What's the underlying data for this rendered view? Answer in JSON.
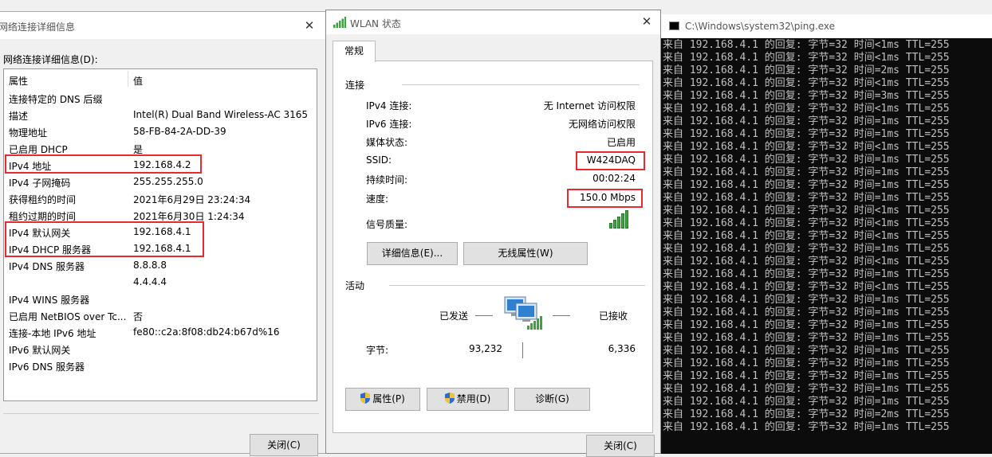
{
  "details_dialog": {
    "title": "网络连接详细信息",
    "caption": "网络连接详细信息(D):",
    "columns": {
      "property": "属性",
      "value": "值"
    },
    "rows": [
      {
        "k": "连接特定的 DNS 后缀",
        "v": ""
      },
      {
        "k": "描述",
        "v": "Intel(R) Dual Band Wireless-AC 3165"
      },
      {
        "k": "物理地址",
        "v": "58-FB-84-2A-DD-39"
      },
      {
        "k": "已启用 DHCP",
        "v": "是"
      },
      {
        "k": "IPv4 地址",
        "v": "192.168.4.2"
      },
      {
        "k": "IPv4 子网掩码",
        "v": "255.255.255.0"
      },
      {
        "k": "获得租约的时间",
        "v": "2021年6月29日 23:24:34"
      },
      {
        "k": "租约过期的时间",
        "v": "2021年6月30日 1:24:34"
      },
      {
        "k": "IPv4 默认网关",
        "v": "192.168.4.1"
      },
      {
        "k": "IPv4 DHCP 服务器",
        "v": "192.168.4.1"
      },
      {
        "k": "IPv4 DNS 服务器",
        "v": "8.8.8.8"
      },
      {
        "k": "",
        "v": "4.4.4.4"
      },
      {
        "k": "IPv4 WINS 服务器",
        "v": ""
      },
      {
        "k": "已启用 NetBIOS over Tc...",
        "v": "否"
      },
      {
        "k": "连接-本地 IPv6 地址",
        "v": "fe80::c2a:8f08:db24:b67d%16"
      },
      {
        "k": "IPv6 默认网关",
        "v": ""
      },
      {
        "k": "IPv6 DNS 服务器",
        "v": ""
      }
    ],
    "close_label": "关闭(C)"
  },
  "wlan_dialog": {
    "title": "WLAN 状态",
    "tab": "常规",
    "connection_group": "连接",
    "fields": [
      {
        "k": "IPv4 连接:",
        "v": "无 Internet 访问权限"
      },
      {
        "k": "IPv6 连接:",
        "v": "无网络访问权限"
      },
      {
        "k": "媒体状态:",
        "v": "已启用"
      },
      {
        "k": "SSID:",
        "v": "W424DAQ"
      },
      {
        "k": "持续时间:",
        "v": "00:02:24"
      },
      {
        "k": "速度:",
        "v": "150.0 Mbps"
      }
    ],
    "signal_label": "信号质量:",
    "details_button": "详细信息(E)...",
    "wireless_props_button": "无线属性(W)",
    "activity_group": "活动",
    "sent_label": "已发送",
    "received_label": "已接收",
    "bytes_label": "字节:",
    "bytes_sent": "93,232",
    "bytes_received": "6,336",
    "properties_button": "属性(P)",
    "disable_button": "禁用(D)",
    "diagnose_button": "诊断(G)",
    "close_label": "关闭(C)"
  },
  "ping_console": {
    "title": "C:\\Windows\\system32\\ping.exe",
    "lines": [
      "来自 192.168.4.1 的回复: 字节=32 时间<1ms TTL=255",
      "来自 192.168.4.1 的回复: 字节=32 时间<1ms TTL=255",
      "来自 192.168.4.1 的回复: 字节=32 时间=2ms TTL=255",
      "来自 192.168.4.1 的回复: 字节=32 时间<1ms TTL=255",
      "来自 192.168.4.1 的回复: 字节=32 时间=3ms TTL=255",
      "来自 192.168.4.1 的回复: 字节=32 时间<1ms TTL=255",
      "来自 192.168.4.1 的回复: 字节=32 时间=1ms TTL=255",
      "来自 192.168.4.1 的回复: 字节=32 时间=1ms TTL=255",
      "来自 192.168.4.1 的回复: 字节=32 时间<1ms TTL=255",
      "来自 192.168.4.1 的回复: 字节=32 时间=1ms TTL=255",
      "来自 192.168.4.1 的回复: 字节=32 时间=1ms TTL=255",
      "来自 192.168.4.1 的回复: 字节=32 时间=1ms TTL=255",
      "来自 192.168.4.1 的回复: 字节=32 时间=1ms TTL=255",
      "来自 192.168.4.1 的回复: 字节=32 时间<1ms TTL=255",
      "来自 192.168.4.1 的回复: 字节=32 时间<1ms TTL=255",
      "来自 192.168.4.1 的回复: 字节=32 时间<1ms TTL=255",
      "来自 192.168.4.1 的回复: 字节=32 时间=1ms TTL=255",
      "来自 192.168.4.1 的回复: 字节=32 时间<1ms TTL=255",
      "来自 192.168.4.1 的回复: 字节=32 时间=1ms TTL=255",
      "来自 192.168.4.1 的回复: 字节=32 时间<1ms TTL=255",
      "来自 192.168.4.1 的回复: 字节=32 时间=1ms TTL=255",
      "来自 192.168.4.1 的回复: 字节=32 时间=1ms TTL=255",
      "来自 192.168.4.1 的回复: 字节=32 时间=1ms TTL=255",
      "来自 192.168.4.1 的回复: 字节=32 时间=1ms TTL=255",
      "来自 192.168.4.1 的回复: 字节=32 时间=1ms TTL=255",
      "来自 192.168.4.1 的回复: 字节=32 时间=1ms TTL=255",
      "来自 192.168.4.1 的回复: 字节=32 时间=1ms TTL=255",
      "来自 192.168.4.1 的回复: 字节=32 时间=1ms TTL=255",
      "来自 192.168.4.1 的回复: 字节=32 时间=1ms TTL=255",
      "来自 192.168.4.1 的回复: 字节=32 时间=2ms TTL=255",
      "来自 192.168.4.1 的回复: 字节=32 时间=1ms TTL=255"
    ]
  },
  "colors": {
    "highlight_box": "#e8292f",
    "console_bg": "#0c0c0c",
    "console_text": "#c0c0c0",
    "signal_green": "#3aa53a"
  },
  "icons": [
    "wifi-signal-icon",
    "network-computers-icon",
    "uac-shield-icon",
    "console-icon",
    "close-icon"
  ]
}
